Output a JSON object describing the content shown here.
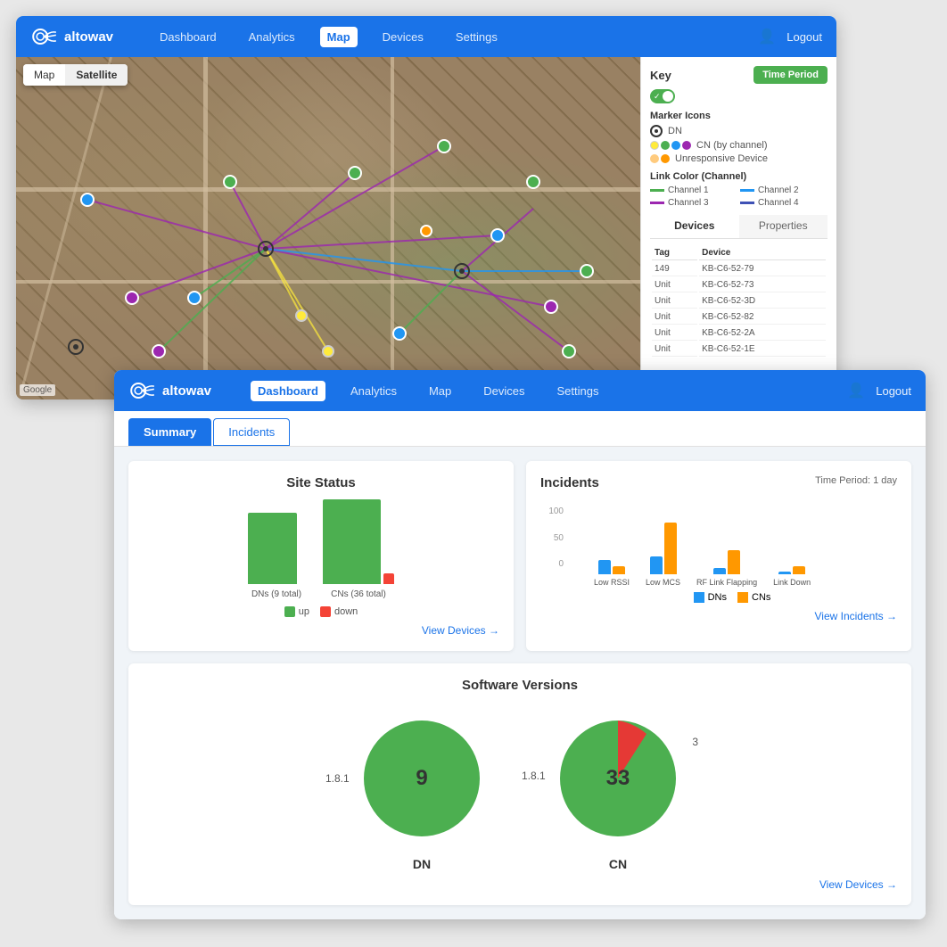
{
  "brand": "altowav",
  "map_window": {
    "nav": {
      "dashboard": "Dashboard",
      "analytics": "Analytics",
      "map": "Map",
      "devices": "Devices",
      "settings": "Settings",
      "logout": "Logout",
      "active": "Map"
    },
    "map_toggles": {
      "map": "Map",
      "satellite": "Satellite",
      "active": "Satellite"
    },
    "google_label": "Google",
    "key": {
      "title": "Key",
      "time_period_btn": "Time Period",
      "marker_icons_title": "Marker Icons",
      "dn_label": "DN",
      "cn_label": "CN (by channel)",
      "unresponsive_label": "Unresponsive Device",
      "link_color_title": "Link Color (Channel)",
      "channel1": "Channel 1",
      "channel2": "Channel 2",
      "channel3": "Channel 3",
      "channel4": "Channel 4"
    },
    "panel_tabs": [
      "Devices",
      "Properties"
    ],
    "devices_table": {
      "headers": [
        "Tag",
        "Device"
      ],
      "rows": [
        {
          "tag": "149",
          "device": "KB-C6-52-79"
        },
        {
          "tag": "Unit",
          "device": "KB-C6-52-73"
        },
        {
          "tag": "Unit",
          "device": "KB-C6-52-3D"
        },
        {
          "tag": "Unit",
          "device": "KB-C6-52-82"
        },
        {
          "tag": "Unit",
          "device": "KB-C6-52-2A"
        },
        {
          "tag": "Unit",
          "device": "KB-C6-52-1E"
        }
      ]
    }
  },
  "dashboard_window": {
    "nav": {
      "dashboard": "Dashboard",
      "analytics": "Analytics",
      "map": "Map",
      "devices": "Devices",
      "settings": "Settings",
      "logout": "Logout",
      "active": "Dashboard"
    },
    "tabs": {
      "summary": "Summary",
      "incidents": "Incidents",
      "active": "summary"
    },
    "site_status": {
      "title": "Site Status",
      "dn_label": "DNs (9 total)",
      "cn_label": "CNs (36 total)",
      "legend_up": "up",
      "legend_down": "down",
      "view_link": "View Devices →",
      "dn_up_height": 80,
      "dn_down_height": 0,
      "cn_up_height": 95,
      "cn_down_height": 12
    },
    "incidents": {
      "title": "Incidents",
      "time_period": "Time Period: 1 day",
      "y_labels": [
        "100",
        "50",
        "0"
      ],
      "categories": [
        {
          "label": "Low RSSI",
          "dns": 18,
          "cns": 10
        },
        {
          "label": "Low MCS",
          "dns": 22,
          "cns": 65
        },
        {
          "label": "RF Link Flapping",
          "dns": 8,
          "cns": 30
        },
        {
          "label": "Link Down",
          "dns": 3,
          "cns": 10
        }
      ],
      "legend_dns": "DNs",
      "legend_cns": "CNs",
      "view_link": "View Incidents →"
    },
    "software_versions": {
      "title": "Software Versions",
      "dn": {
        "label": "DN",
        "version": "1.8.1",
        "count": "9",
        "green_pct": 100,
        "red_pct": 0
      },
      "cn": {
        "label": "CN",
        "version": "1.8.1",
        "count": "33",
        "other_count": "3",
        "green_pct": 91,
        "red_pct": 9
      },
      "view_link": "View Devices →"
    }
  }
}
